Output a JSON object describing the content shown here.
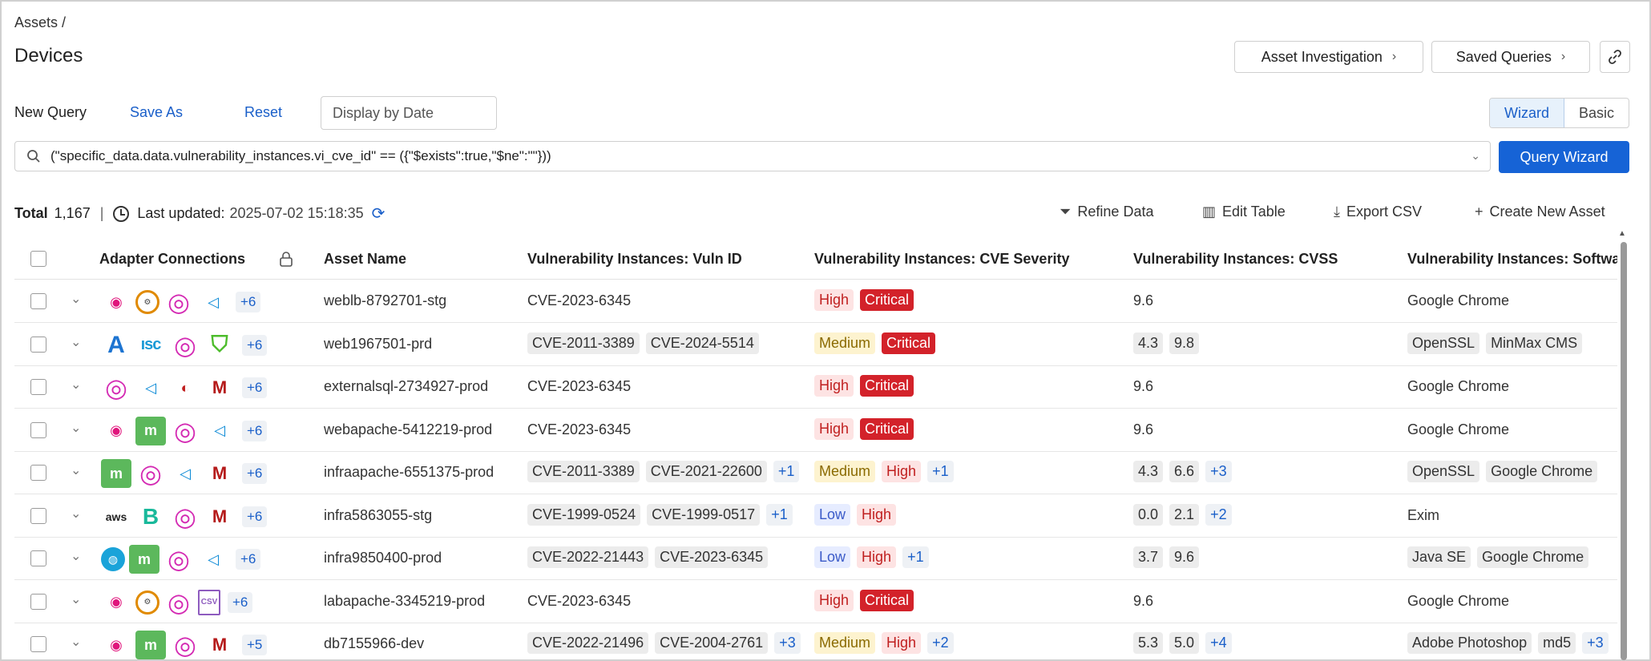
{
  "breadcrumb": "Assets /",
  "page_title": "Devices",
  "header_buttons": {
    "asset_investigation": "Asset Investigation",
    "saved_queries": "Saved Queries"
  },
  "query_bar": {
    "new_query": "New Query",
    "save_as": "Save As",
    "reset": "Reset",
    "date_placeholder": "Display by Date",
    "mode_wizard": "Wizard",
    "mode_basic": "Basic",
    "query_text": "(\"specific_data.data.vulnerability_instances.vi_cve_id\" == ({\"$exists\":true,\"$ne\":\"\"}))",
    "query_wizard_button": "Query Wizard"
  },
  "summary": {
    "total_label": "Total",
    "total_value": "1,167",
    "last_updated_label": "Last updated:",
    "last_updated_value": "2025-07-02 15:18:35"
  },
  "toolbar": {
    "refine_data": "Refine Data",
    "edit_table": "Edit Table",
    "export_csv": "Export CSV",
    "create_new_asset": "Create New Asset"
  },
  "columns": {
    "adapters": "Adapter Connections",
    "asset_name": "Asset Name",
    "vuln_id": "Vulnerability Instances: Vuln ID",
    "severity": "Vulnerability Instances: CVE Severity",
    "cvss": "Vulnerability Instances: CVSS",
    "software": "Vulnerability Instances: Software I"
  },
  "rows": [
    {
      "adapters": [
        "infinity",
        "system",
        "target",
        "act"
      ],
      "adapter_more": "+6",
      "name": "weblb-8792701-stg",
      "vuln_ids": [
        "CVE-2023-6345"
      ],
      "vuln_more": "",
      "severities": [
        "High",
        "Critical"
      ],
      "sev_more": "",
      "cvss": [
        "9.6"
      ],
      "cvss_more": "",
      "software": [
        "Google Chrome"
      ],
      "software_more": ""
    },
    {
      "adapters": [
        "azure",
        "cisco",
        "target",
        "shield"
      ],
      "adapter_more": "+6",
      "name": "web1967501-prd",
      "vuln_ids": [
        "CVE-2011-3389",
        "CVE-2024-5514"
      ],
      "vuln_more": "",
      "severities": [
        "Medium",
        "Critical"
      ],
      "sev_more": "",
      "cvss": [
        "4.3",
        "9.8"
      ],
      "cvss_more": "",
      "software": [
        "OpenSSL",
        "MinMax CMS"
      ],
      "software_more": ""
    },
    {
      "adapters": [
        "target",
        "act",
        "ds",
        "mcafee"
      ],
      "adapter_more": "+6",
      "name": "externalsql-2734927-prod",
      "vuln_ids": [
        "CVE-2023-6345"
      ],
      "vuln_more": "",
      "severities": [
        "High",
        "Critical"
      ],
      "sev_more": "",
      "cvss": [
        "9.6"
      ],
      "cvss_more": "",
      "software": [
        "Google Chrome"
      ],
      "software_more": ""
    },
    {
      "adapters": [
        "infinity",
        "green",
        "target",
        "act"
      ],
      "adapter_more": "+6",
      "name": "webapache-5412219-prod",
      "vuln_ids": [
        "CVE-2023-6345"
      ],
      "vuln_more": "",
      "severities": [
        "High",
        "Critical"
      ],
      "sev_more": "",
      "cvss": [
        "9.6"
      ],
      "cvss_more": "",
      "software": [
        "Google Chrome"
      ],
      "software_more": ""
    },
    {
      "adapters": [
        "green",
        "target",
        "act",
        "mcafee"
      ],
      "adapter_more": "+6",
      "name": "infraapache-6551375-prod",
      "vuln_ids": [
        "CVE-2011-3389",
        "CVE-2021-22600"
      ],
      "vuln_more": "+1",
      "severities": [
        "Medium",
        "High"
      ],
      "sev_more": "+1",
      "cvss": [
        "4.3",
        "6.6"
      ],
      "cvss_more": "+3",
      "software": [
        "OpenSSL",
        "Google Chrome"
      ],
      "software_more": ""
    },
    {
      "adapters": [
        "aws",
        "b",
        "target",
        "mcafee"
      ],
      "adapter_more": "+6",
      "name": "infra5863055-stg",
      "vuln_ids": [
        "CVE-1999-0524",
        "CVE-1999-0517"
      ],
      "vuln_more": "+1",
      "severities": [
        "Low",
        "High"
      ],
      "sev_more": "",
      "cvss": [
        "0.0",
        "2.1"
      ],
      "cvss_more": "+2",
      "software": [
        "Exim"
      ],
      "software_more": ""
    },
    {
      "adapters": [
        "globe",
        "green",
        "target",
        "act"
      ],
      "adapter_more": "+6",
      "name": "infra9850400-prod",
      "vuln_ids": [
        "CVE-2022-21443",
        "CVE-2023-6345"
      ],
      "vuln_more": "",
      "severities": [
        "Low",
        "High"
      ],
      "sev_more": "+1",
      "cvss": [
        "3.7",
        "9.6"
      ],
      "cvss_more": "",
      "software": [
        "Java SE",
        "Google Chrome"
      ],
      "software_more": ""
    },
    {
      "adapters": [
        "infinity",
        "system",
        "target",
        "csv"
      ],
      "adapter_more": "+6",
      "name": "labapache-3345219-prod",
      "vuln_ids": [
        "CVE-2023-6345"
      ],
      "vuln_more": "",
      "severities": [
        "High",
        "Critical"
      ],
      "sev_more": "",
      "cvss": [
        "9.6"
      ],
      "cvss_more": "",
      "software": [
        "Google Chrome"
      ],
      "software_more": ""
    },
    {
      "adapters": [
        "infinity",
        "green",
        "target",
        "mcafee"
      ],
      "adapter_more": "+5",
      "name": "db7155966-dev",
      "vuln_ids": [
        "CVE-2022-21496",
        "CVE-2004-2761"
      ],
      "vuln_more": "+3",
      "severities": [
        "Medium",
        "High"
      ],
      "sev_more": "+2",
      "cvss": [
        "5.3",
        "5.0"
      ],
      "cvss_more": "+4",
      "software": [
        "Adobe Photoshop",
        "md5"
      ],
      "software_more": "+3"
    }
  ]
}
